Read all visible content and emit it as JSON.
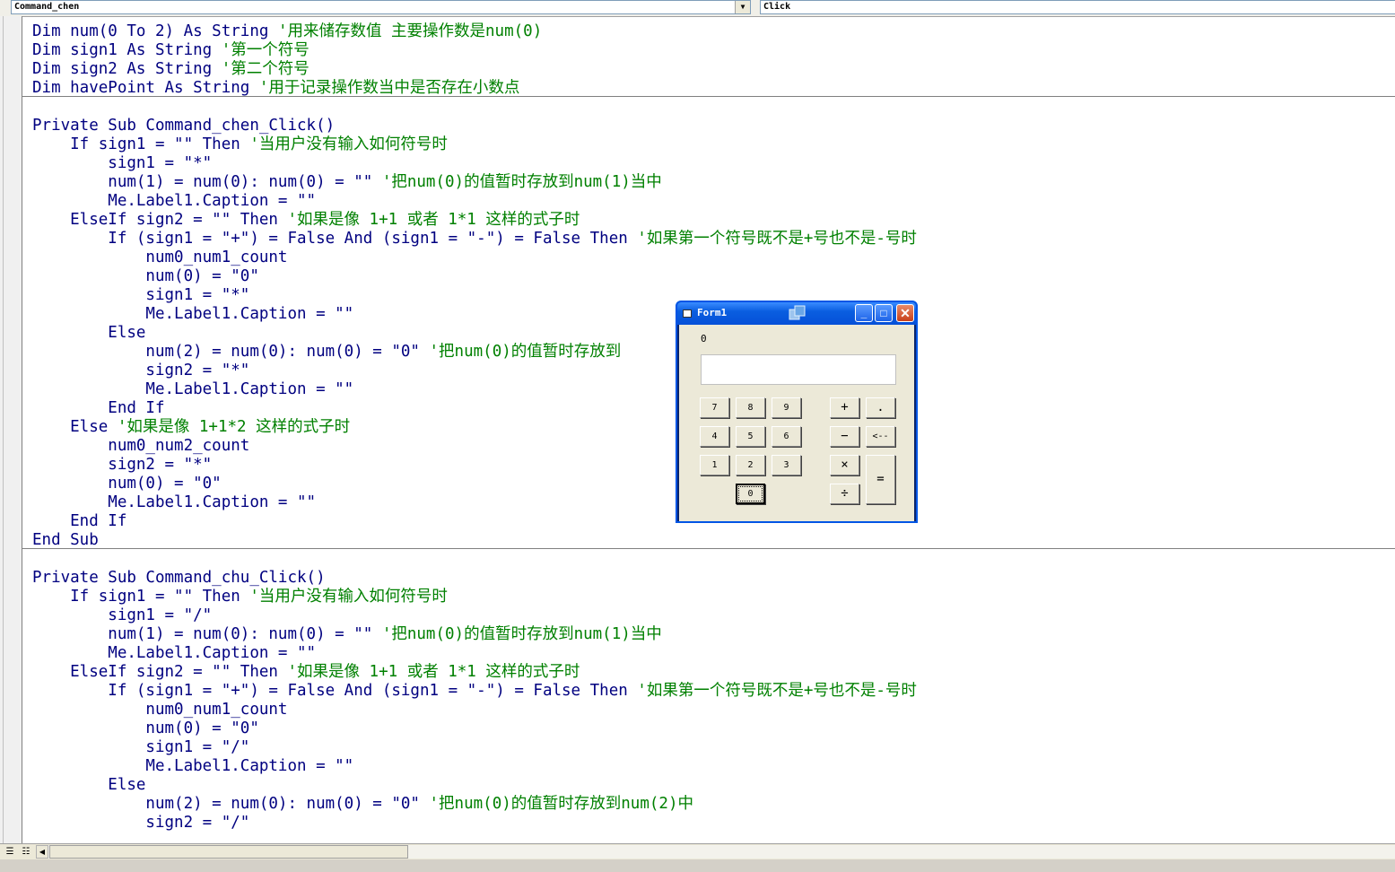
{
  "toolbar": {
    "object_combo": "Command_chen",
    "procedure_combo": "Click"
  },
  "code": {
    "lines": [
      {
        "code": "Dim num(0 To 2) As String ",
        "comment": "'用来储存数值 主要操作数是num(0)"
      },
      {
        "code": "Dim sign1 As String ",
        "comment": "'第一个符号"
      },
      {
        "code": "Dim sign2 As String ",
        "comment": "'第二个符号"
      },
      {
        "code": "Dim havePoint As String ",
        "comment": "'用于记录操作数当中是否存在小数点"
      },
      {
        "code": "",
        "comment": ""
      },
      {
        "code": "Private Sub Command_chen_Click()",
        "comment": ""
      },
      {
        "code": "    If sign1 = \"\" Then ",
        "comment": "'当用户没有输入如何符号时"
      },
      {
        "code": "        sign1 = \"*\"",
        "comment": ""
      },
      {
        "code": "        num(1) = num(0): num(0) = \"\" ",
        "comment": "'把num(0)的值暂时存放到num(1)当中"
      },
      {
        "code": "        Me.Label1.Caption = \"\"",
        "comment": ""
      },
      {
        "code": "    ElseIf sign2 = \"\" Then ",
        "comment": "'如果是像 1+1 或者 1*1 这样的式子时"
      },
      {
        "code": "        If (sign1 = \"+\") = False And (sign1 = \"-\") = False Then ",
        "comment": "'如果第一个符号既不是+号也不是-号时"
      },
      {
        "code": "            num0_num1_count",
        "comment": ""
      },
      {
        "code": "            num(0) = \"0\"",
        "comment": ""
      },
      {
        "code": "            sign1 = \"*\"",
        "comment": ""
      },
      {
        "code": "            Me.Label1.Caption = \"\"",
        "comment": ""
      },
      {
        "code": "        Else",
        "comment": ""
      },
      {
        "code": "            num(2) = num(0): num(0) = \"0\" ",
        "comment": "'把num(0)的值暂时存放到"
      },
      {
        "code": "            sign2 = \"*\"",
        "comment": ""
      },
      {
        "code": "            Me.Label1.Caption = \"\"",
        "comment": ""
      },
      {
        "code": "        End If",
        "comment": ""
      },
      {
        "code": "    Else ",
        "comment": "'如果是像 1+1*2 这样的式子时"
      },
      {
        "code": "        num0_num2_count",
        "comment": ""
      },
      {
        "code": "        sign2 = \"*\"",
        "comment": ""
      },
      {
        "code": "        num(0) = \"0\"",
        "comment": ""
      },
      {
        "code": "        Me.Label1.Caption = \"\"",
        "comment": ""
      },
      {
        "code": "    End If",
        "comment": ""
      },
      {
        "code": "End Sub",
        "comment": ""
      },
      {
        "code": "",
        "comment": ""
      },
      {
        "code": "Private Sub Command_chu_Click()",
        "comment": ""
      },
      {
        "code": "    If sign1 = \"\" Then ",
        "comment": "'当用户没有输入如何符号时"
      },
      {
        "code": "        sign1 = \"/\"",
        "comment": ""
      },
      {
        "code": "        num(1) = num(0): num(0) = \"\" ",
        "comment": "'把num(0)的值暂时存放到num(1)当中"
      },
      {
        "code": "        Me.Label1.Caption = \"\"",
        "comment": ""
      },
      {
        "code": "    ElseIf sign2 = \"\" Then ",
        "comment": "'如果是像 1+1 或者 1*1 这样的式子时"
      },
      {
        "code": "        If (sign1 = \"+\") = False And (sign1 = \"-\") = False Then ",
        "comment": "'如果第一个符号既不是+号也不是-号时"
      },
      {
        "code": "            num0_num1_count",
        "comment": ""
      },
      {
        "code": "            num(0) = \"0\"",
        "comment": ""
      },
      {
        "code": "            sign1 = \"/\"",
        "comment": ""
      },
      {
        "code": "            Me.Label1.Caption = \"\"",
        "comment": ""
      },
      {
        "code": "        Else",
        "comment": ""
      },
      {
        "code": "            num(2) = num(0): num(0) = \"0\" ",
        "comment": "'把num(0)的值暂时存放到num(2)中"
      },
      {
        "code": "            sign2 = \"/\"",
        "comment": ""
      }
    ]
  },
  "form1": {
    "title": "Form1",
    "label": "0",
    "textbox_value": "",
    "buttons": {
      "b7": "7",
      "b8": "8",
      "b9": "9",
      "b4": "4",
      "b5": "5",
      "b6": "6",
      "b1": "1",
      "b2": "2",
      "b3": "3",
      "b0": "0",
      "plus": "+",
      "point": ".",
      "minus": "−",
      "back": "<--",
      "times": "×",
      "divide": "÷",
      "equals": "="
    }
  }
}
